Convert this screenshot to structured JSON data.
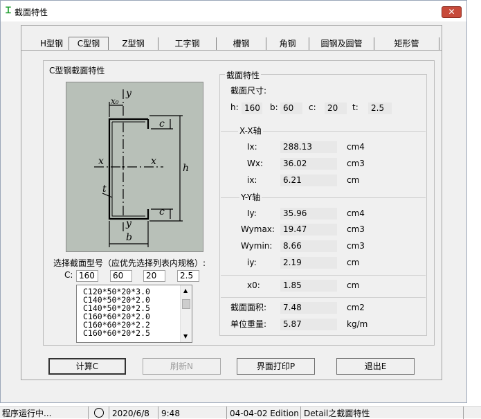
{
  "window": {
    "title": "截面特性",
    "close_label": "✕"
  },
  "tabs": [
    {
      "label": "H型钢"
    },
    {
      "label": "C型钢"
    },
    {
      "label": "Z型钢"
    },
    {
      "label": "工字钢"
    },
    {
      "label": "槽钢"
    },
    {
      "label": "角钢"
    },
    {
      "label": "圆钢及圆管"
    },
    {
      "label": "矩形管"
    }
  ],
  "left_group": {
    "title": "C型钢截面特性",
    "diagram_labels": {
      "y_top": "y",
      "x0": "x₀",
      "c_top": "c",
      "x_left": "x",
      "x_right": "x",
      "h": "h",
      "t": "t",
      "c_bottom": "c",
      "y_bottom": "y",
      "b": "b"
    },
    "select_label": "选择截面型号（应优先选择列表内规格）:",
    "c_label": "C:",
    "inputs": [
      "160",
      "60",
      "20",
      "2.5"
    ],
    "list_items": [
      "C120*50*20*3.0",
      "C140*50*20*2.0",
      "C140*50*20*2.5",
      "C160*60*20*2.0",
      "C160*60*20*2.2",
      "C160*60*20*2.5"
    ]
  },
  "right_group": {
    "title": "截面特性",
    "size_title": "截面尺寸:",
    "dims": [
      {
        "label": "h:",
        "value": "160"
      },
      {
        "label": "b:",
        "value": "60"
      },
      {
        "label": "c:",
        "value": "20"
      },
      {
        "label": "t:",
        "value": "2.5"
      }
    ],
    "xx_title": "X-X轴",
    "xx": [
      {
        "label": "Ix:",
        "value": "288.13",
        "unit": "cm4"
      },
      {
        "label": "Wx:",
        "value": "36.02",
        "unit": "cm3"
      },
      {
        "label": "ix:",
        "value": "6.21",
        "unit": "cm"
      }
    ],
    "yy_title": "Y-Y轴",
    "yy": [
      {
        "label": "Iy:",
        "value": "35.96",
        "unit": "cm4"
      },
      {
        "label": "Wymax:",
        "value": "19.47",
        "unit": "cm3"
      },
      {
        "label": "Wymin:",
        "value": "8.66",
        "unit": "cm3"
      },
      {
        "label": "iy:",
        "value": "2.19",
        "unit": "cm"
      }
    ],
    "x0": {
      "label": "x0:",
      "value": "1.85",
      "unit": "cm"
    },
    "area": {
      "label": "截面面积:",
      "value": "7.48",
      "unit": "cm2"
    },
    "weight": {
      "label": "单位重量:",
      "value": "5.87",
      "unit": "kg/m"
    }
  },
  "buttons": {
    "calc": "计算C",
    "refresh": "刷新N",
    "print": "界面打印P",
    "exit": "退出E"
  },
  "status": [
    "程序运行中...",
    "2020/6/8",
    "9:48",
    "04-04-02 Edition",
    "Detail之截面特性"
  ]
}
